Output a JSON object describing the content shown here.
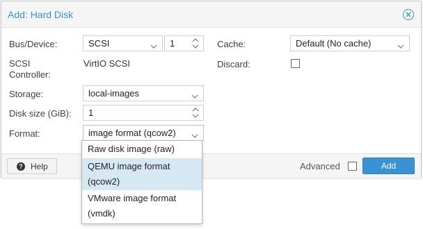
{
  "dialog": {
    "title": "Add: Hard Disk"
  },
  "form": {
    "bus_device": {
      "label": "Bus/Device:",
      "bus_value": "SCSI",
      "device_value": "1"
    },
    "scsi_controller": {
      "label_line1": "SCSI",
      "label_line2": "Controller:",
      "value": "VirtIO SCSI"
    },
    "storage": {
      "label": "Storage:",
      "value": "local-images"
    },
    "disk_size": {
      "label": "Disk size (GiB):",
      "value": "1"
    },
    "format": {
      "label": "Format:",
      "value": "image format (qcow2)"
    },
    "cache": {
      "label": "Cache:",
      "value": "Default (No cache)"
    },
    "discard": {
      "label": "Discard:",
      "checked": false
    }
  },
  "format_dropdown": {
    "options": [
      {
        "line1": "Raw disk image (raw)",
        "line2": ""
      },
      {
        "line1": "QEMU image format",
        "line2": "(qcow2)"
      },
      {
        "line1": "VMware image format",
        "line2": "(vmdk)"
      }
    ],
    "selected_index": 1
  },
  "footer": {
    "help_label": "Help",
    "advanced_label": "Advanced",
    "advanced_checked": false,
    "add_label": "Add"
  },
  "colors": {
    "accent": "#3892d4",
    "selected_option_bg": "#d7e8f5"
  },
  "icons": {
    "close": "close-circle-icon",
    "help": "help-circle-icon",
    "dropdown": "chevron-down-icon",
    "spinner": "spinner-arrows-icon"
  }
}
